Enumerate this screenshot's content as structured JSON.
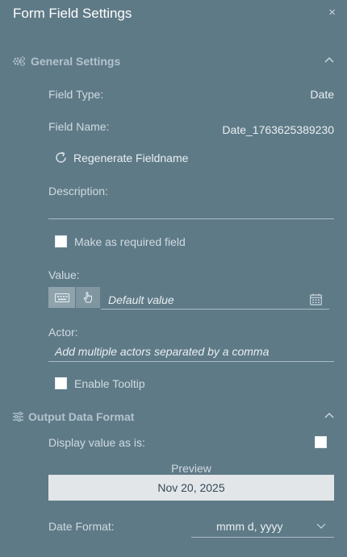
{
  "panel": {
    "title": "Form Field Settings",
    "close_glyph": "×"
  },
  "general": {
    "header": "General Settings",
    "icon": "gears-icon",
    "field_type_label": "Field Type:",
    "field_type_value": "Date",
    "field_name_label": "Field Name:",
    "field_name_value": "Date_1763625389230",
    "regenerate_label": "Regenerate Fieldname",
    "description_label": "Description:",
    "description_value": "",
    "required_label": "Make as required field",
    "required_checked": false,
    "value_label": "Value:",
    "value_placeholder": "Default value",
    "actor_label": "Actor:",
    "actor_placeholder": "Add multiple actors separated by a comma",
    "tooltip_label": "Enable Tooltip",
    "tooltip_checked": false
  },
  "output": {
    "header": "Output Data Format",
    "icon": "sliders-icon",
    "display_as_is_label": "Display value as is:",
    "display_as_is_checked": false,
    "preview_label": "Preview",
    "preview_value": "Nov 20, 2025",
    "date_format_label": "Date Format:",
    "date_format_value": "mmm d, yyyy"
  },
  "colors": {
    "background": "#5f7a87",
    "preview_bg": "#e2e6e8",
    "toggle_active": "#8fa3ad"
  }
}
